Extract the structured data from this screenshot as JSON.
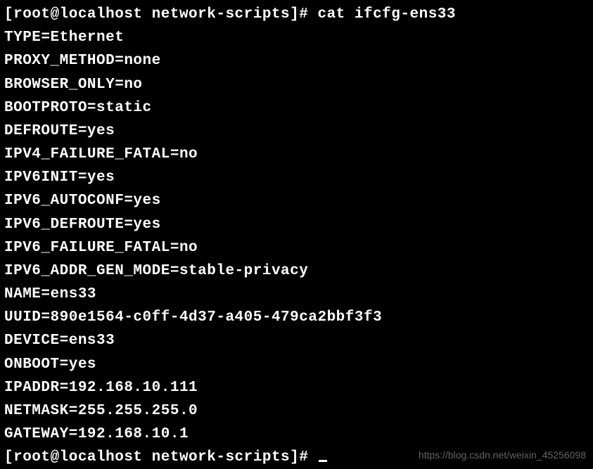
{
  "terminal": {
    "prompt1": "[root@localhost network-scripts]# cat ifcfg-ens33",
    "lines": [
      "TYPE=Ethernet",
      "PROXY_METHOD=none",
      "BROWSER_ONLY=no",
      "BOOTPROTO=static",
      "DEFROUTE=yes",
      "IPV4_FAILURE_FATAL=no",
      "IPV6INIT=yes",
      "IPV6_AUTOCONF=yes",
      "IPV6_DEFROUTE=yes",
      "IPV6_FAILURE_FATAL=no",
      "IPV6_ADDR_GEN_MODE=stable-privacy",
      "NAME=ens33",
      "UUID=890e1564-c0ff-4d37-a405-479ca2bbf3f3",
      "DEVICE=ens33",
      "ONBOOT=yes",
      "IPADDR=192.168.10.111",
      "NETMASK=255.255.255.0",
      "GATEWAY=192.168.10.1"
    ],
    "prompt2": "[root@localhost network-scripts]# "
  },
  "watermark": "https://blog.csdn.net/weixin_45256098"
}
